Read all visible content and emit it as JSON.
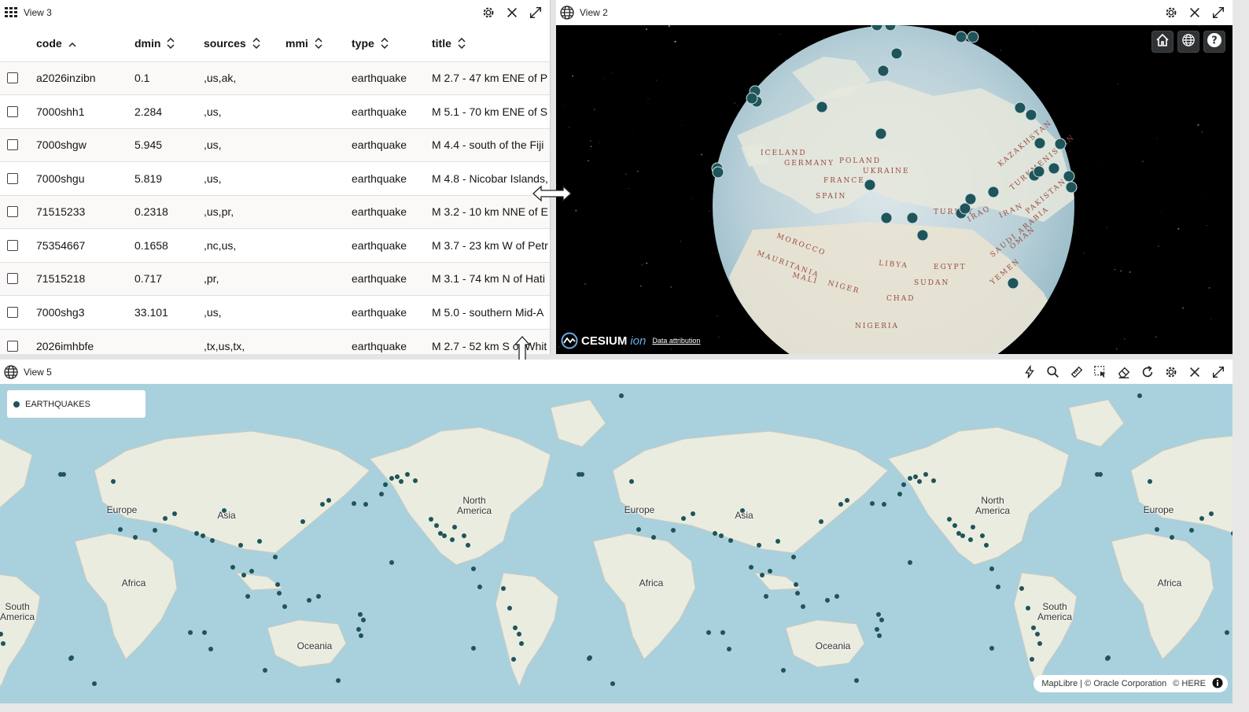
{
  "view3": {
    "title": "View 3",
    "columns": [
      "code",
      "dmin",
      "sources",
      "mmi",
      "type",
      "title"
    ],
    "rows": [
      {
        "code": "a2026inzibn",
        "dmin": "0.1",
        "sources": ",us,ak,",
        "mmi": "",
        "type": "earthquake",
        "title": "M 2.7 - 47 km ENE of P"
      },
      {
        "code": "7000shh1",
        "dmin": "2.284",
        "sources": ",us,",
        "mmi": "",
        "type": "earthquake",
        "title": "M 5.1 - 70 km ENE of S"
      },
      {
        "code": "7000shgw",
        "dmin": "5.945",
        "sources": ",us,",
        "mmi": "",
        "type": "earthquake",
        "title": "M 4.4 - south of the Fiji"
      },
      {
        "code": "7000shgu",
        "dmin": "5.819",
        "sources": ",us,",
        "mmi": "",
        "type": "earthquake",
        "title": "M 4.8 - Nicobar Islands,"
      },
      {
        "code": "71515233",
        "dmin": "0.2318",
        "sources": ",us,pr,",
        "mmi": "",
        "type": "earthquake",
        "title": "M 3.2 - 10 km NNE of E"
      },
      {
        "code": "75354667",
        "dmin": "0.1658",
        "sources": ",nc,us,",
        "mmi": "",
        "type": "earthquake",
        "title": "M 3.7 - 23 km W of Petr"
      },
      {
        "code": "71515218",
        "dmin": "0.717",
        "sources": ",pr,",
        "mmi": "",
        "type": "earthquake",
        "title": "M 3.1 - 74 km N of Hati"
      },
      {
        "code": "7000shg3",
        "dmin": "33.101",
        "sources": ",us,",
        "mmi": "",
        "type": "earthquake",
        "title": "M 5.0 - southern Mid-A"
      },
      {
        "code": "2026imhbfe",
        "dmin": "",
        "sources": ",tx,us,tx,",
        "mmi": "",
        "type": "earthquake",
        "title": "M 2.7 - 52 km S of Whit"
      }
    ]
  },
  "view2": {
    "title": "View 2",
    "cesium_text": "CESIUM",
    "ion_text": "ion",
    "data_attribution": "Data attribution",
    "globe_labels": [
      "ICELAND",
      "GERMANY",
      "POLAND",
      "UKRAINE",
      "FRANCE",
      "SPAIN",
      "MOROCCO",
      "MAURITANIA",
      "MALI",
      "NIGER",
      "CHAD",
      "SUDAN",
      "LIBYA",
      "EGYPT",
      "TURKEY",
      "IRAQ",
      "IRAN",
      "SAUDI ARABIA",
      "KAZAKHSTAN",
      "NIGERIA",
      "OMAN",
      "YEMEN",
      "PAKISTAN",
      "TURKMENISTAN"
    ]
  },
  "view5": {
    "title": "View 5",
    "legend_label": "EARTHQUAKES",
    "attribution": "MapLibre | © Oracle Corporation",
    "here": "© HERE",
    "labels": [
      "Europe",
      "Asia",
      "Africa",
      "South America",
      "Oceania",
      "North America",
      "Europe",
      "Asia",
      "Africa",
      "Oceania",
      "North America",
      "South America",
      "Europe",
      "Africa",
      "South America"
    ]
  },
  "colors": {
    "quake_dot": "#1e545a",
    "ocean": "#a9d0dd",
    "land": "#e9ecdf",
    "globe_bg": "#000000"
  },
  "icons": [
    "grid-icon",
    "gear-icon",
    "close-icon",
    "expand-icon",
    "globe-icon",
    "home-icon",
    "help-icon",
    "lightning-icon",
    "search-icon",
    "ruler-icon",
    "select-icon",
    "eraser-icon",
    "refresh-icon"
  ]
}
